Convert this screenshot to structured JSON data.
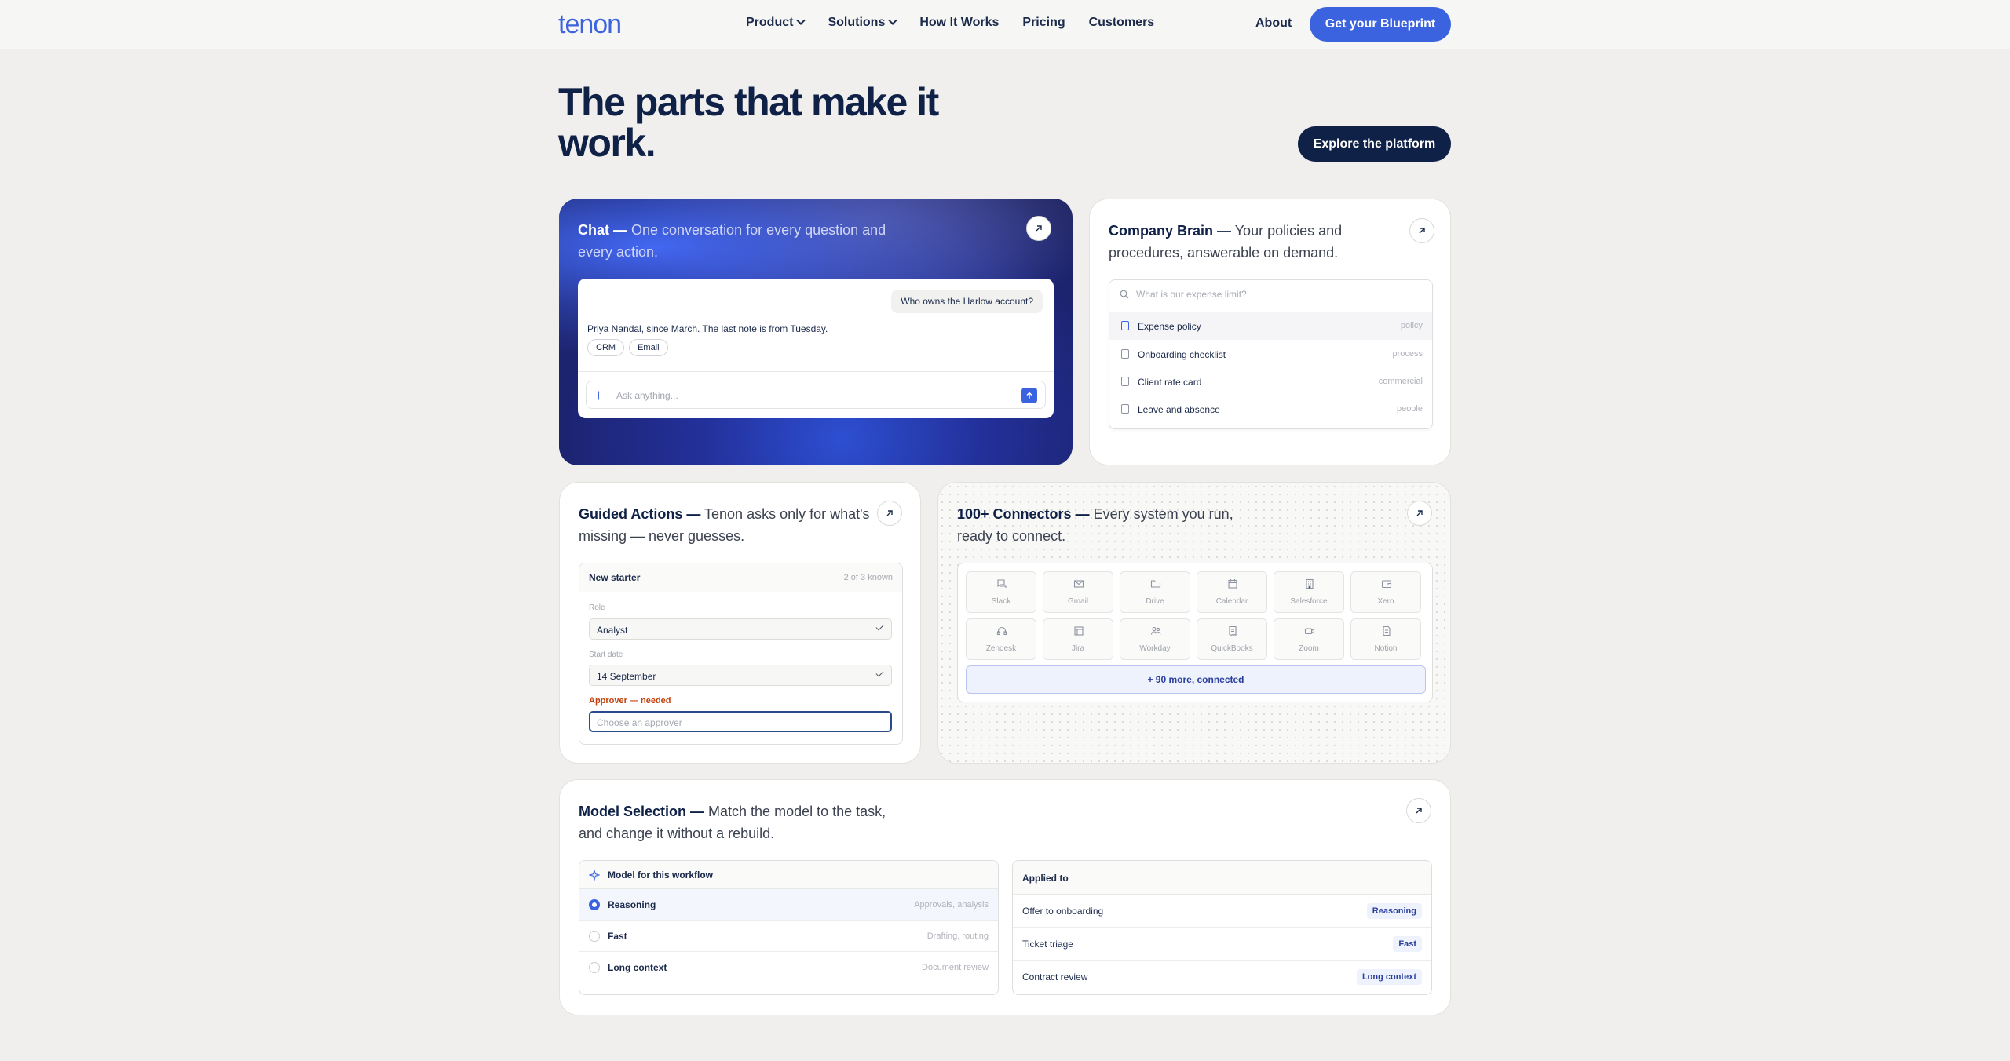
{
  "nav": {
    "logo": "tenon",
    "items": [
      {
        "label": "Product",
        "dropdown": true
      },
      {
        "label": "Solutions",
        "dropdown": true
      },
      {
        "label": "How It Works",
        "dropdown": false
      },
      {
        "label": "Pricing",
        "dropdown": false
      },
      {
        "label": "Customers",
        "dropdown": false
      }
    ],
    "about": "About",
    "cta": "Get your Blueprint"
  },
  "hero": {
    "title": "The parts that make it work.",
    "explore": "Explore the platform"
  },
  "chat": {
    "title_bold": "Chat —",
    "title_rest": " One conversation for every question and every action.",
    "question": "Who owns the Harlow account?",
    "answer": "Priya Nandal, since March. The last note is from Tuesday.",
    "chips": [
      "CRM",
      "Email"
    ],
    "input_placeholder": "Ask anything..."
  },
  "brain": {
    "title_bold": "Company Brain —",
    "title_rest": " Your policies and procedures, answerable on demand.",
    "search_placeholder": "What is our expense limit?",
    "results": [
      {
        "label": "Expense policy",
        "tag": "policy"
      },
      {
        "label": "Onboarding checklist",
        "tag": "process"
      },
      {
        "label": "Client rate card",
        "tag": "commercial"
      },
      {
        "label": "Leave and absence",
        "tag": "people"
      }
    ]
  },
  "guided": {
    "title_bold": "Guided Actions —",
    "title_rest": " Tenon asks only for what's missing — never guesses.",
    "form_title": "New starter",
    "form_count": "2 of 3 known",
    "role_label": "Role",
    "role_value": "Analyst",
    "start_label": "Start date",
    "start_value": "14 September",
    "approver_label": "Approver — needed",
    "approver_placeholder": "Choose an approver"
  },
  "connectors": {
    "title_bold": "100+ Connectors —",
    "title_rest": " Every system you run, ready to connect.",
    "tiles": [
      {
        "name": "Slack",
        "icon": "chat-icon"
      },
      {
        "name": "Gmail",
        "icon": "mail-icon"
      },
      {
        "name": "Drive",
        "icon": "folder-icon"
      },
      {
        "name": "Calendar",
        "icon": "calendar-icon"
      },
      {
        "name": "Salesforce",
        "icon": "building-icon"
      },
      {
        "name": "Xero",
        "icon": "wallet-icon"
      },
      {
        "name": "Zendesk",
        "icon": "headset-icon"
      },
      {
        "name": "Jira",
        "icon": "board-icon"
      },
      {
        "name": "Workday",
        "icon": "users-icon"
      },
      {
        "name": "QuickBooks",
        "icon": "receipt-icon"
      },
      {
        "name": "Zoom",
        "icon": "video-icon"
      },
      {
        "name": "Notion",
        "icon": "doc-icon"
      }
    ],
    "more": "+ 90 more, connected"
  },
  "model": {
    "title_bold": "Model Selection —",
    "title_rest": " Match the model to the task, and change it without a rebuild.",
    "panel_title": "Model for this workflow",
    "options": [
      {
        "name": "Reasoning",
        "desc": "Approvals, analysis",
        "selected": true
      },
      {
        "name": "Fast",
        "desc": "Drafting, routing",
        "selected": false
      },
      {
        "name": "Long context",
        "desc": "Document review",
        "selected": false
      }
    ],
    "applied_title": "Applied to",
    "applied": [
      {
        "name": "Offer to onboarding",
        "model": "Reasoning"
      },
      {
        "name": "Ticket triage",
        "model": "Fast"
      },
      {
        "name": "Contract review",
        "model": "Long context"
      }
    ]
  },
  "colors": {
    "accent": "#3b63e0",
    "navy": "#0f2147",
    "page_bg": "#f0efed"
  }
}
